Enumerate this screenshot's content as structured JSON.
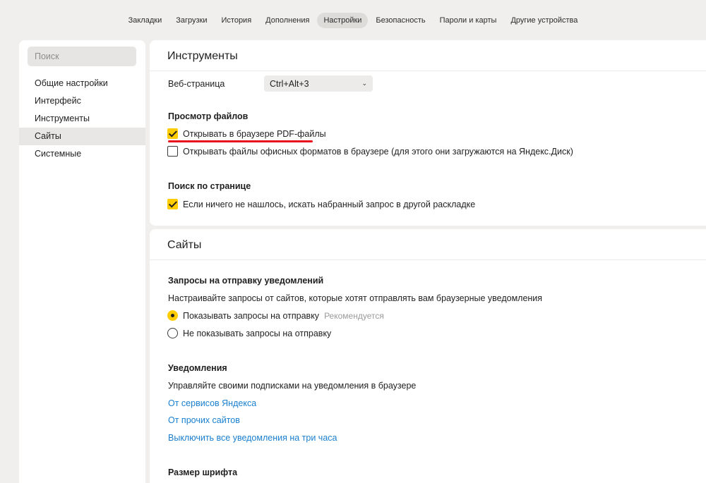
{
  "topnav": {
    "tabs": [
      {
        "label": "Закладки"
      },
      {
        "label": "Загрузки"
      },
      {
        "label": "История"
      },
      {
        "label": "Дополнения"
      },
      {
        "label": "Настройки",
        "active": true
      },
      {
        "label": "Безопасность"
      },
      {
        "label": "Пароли и карты"
      },
      {
        "label": "Другие устройства"
      }
    ]
  },
  "sidebar": {
    "search_placeholder": "Поиск",
    "items": [
      {
        "label": "Общие настройки"
      },
      {
        "label": "Интерфейс"
      },
      {
        "label": "Инструменты"
      },
      {
        "label": "Сайты",
        "active": true
      },
      {
        "label": "Системные"
      }
    ]
  },
  "tools": {
    "title": "Инструменты",
    "webpage_label": "Веб-страница",
    "webpage_shortcut": "Ctrl+Alt+3",
    "file_view": {
      "title": "Просмотр файлов",
      "open_pdf": "Открывать в браузере PDF-файлы",
      "open_pdf_checked": true,
      "open_office": "Открывать файлы офисных форматов в браузере (для этого они загружаются на Яндекс.Диск)",
      "open_office_checked": false
    },
    "page_search": {
      "title": "Поиск по странице",
      "option": "Если ничего не нашлось, искать набранный запрос в другой раскладке",
      "option_checked": true
    }
  },
  "sites": {
    "title": "Сайты",
    "notif_requests": {
      "title": "Запросы на отправку уведомлений",
      "description": "Настраивайте запросы от сайтов, которые хотят отправлять вам браузерные уведомления",
      "show": "Показывать запросы на отправку",
      "show_hint": "Рекомендуется",
      "hide": "Не показывать запросы на отправку",
      "selected": "show"
    },
    "notifications": {
      "title": "Уведомления",
      "description": "Управляйте своими подписками на уведомления в браузере",
      "link_yandex": "От сервисов Яндекса",
      "link_other": "От прочих сайтов",
      "link_disable": "Выключить все уведомления на три часа"
    },
    "font_size": {
      "title": "Размер шрифта"
    }
  },
  "colors": {
    "accent": "#ffcc00",
    "link": "#1a7fcf",
    "highlight_underline": "#e8101c"
  }
}
